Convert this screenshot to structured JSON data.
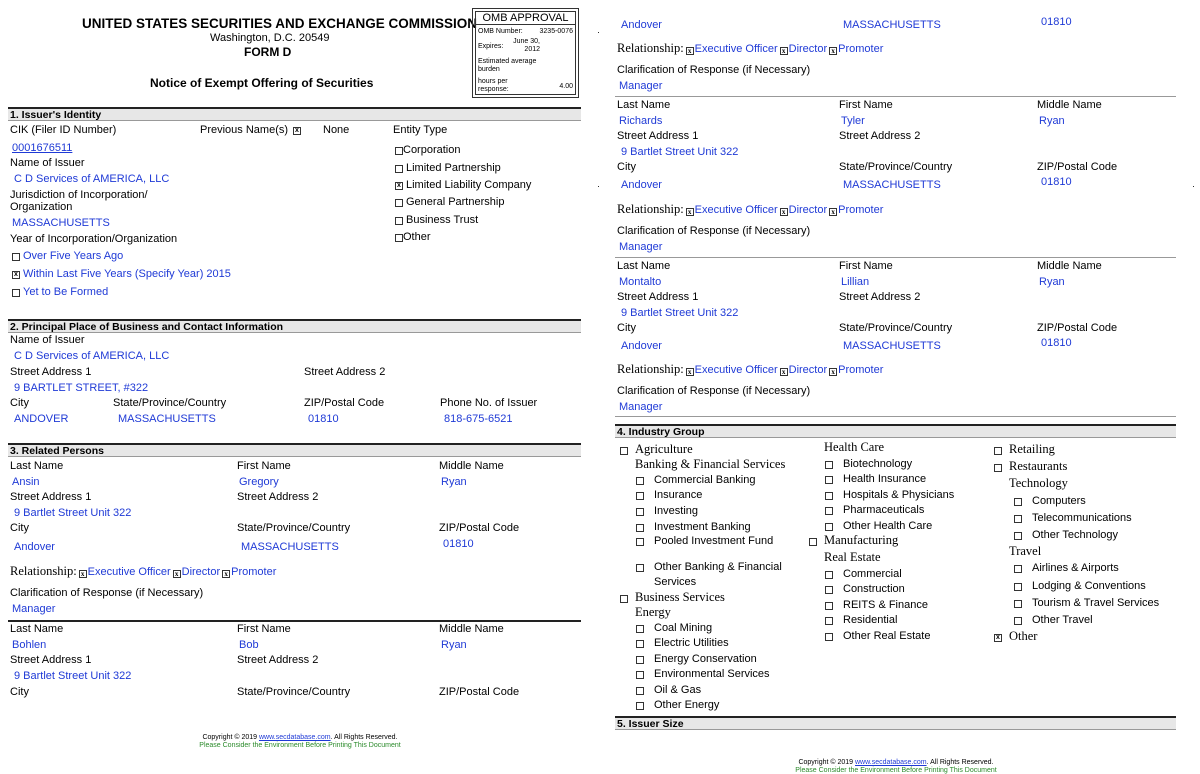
{
  "header": {
    "title": "UNITED STATES SECURITIES AND EXCHANGE COMMISSION",
    "city": "Washington, D.C. 20549",
    "form": "FORM D",
    "subtitle": "Notice of Exempt Offering of Securities"
  },
  "omb": {
    "title": "OMB APPROVAL",
    "number_label": "OMB Number:",
    "number": "3235-0076",
    "expires_label": "Expires:",
    "expires_1": "June 30,",
    "expires_2": "2012",
    "burden_1": "Estimated average",
    "burden_2": "burden",
    "hours_1": "hours per",
    "hours_2": "response:",
    "hours": "4.00"
  },
  "s1": {
    "title": "1. Issuer's Identity",
    "cik_label": "CIK (Filer ID Number)",
    "cik": "0001676511",
    "prev_label": "Previous Name(s)",
    "prev_check": "x",
    "prev_value": "None",
    "entity_label": "Entity Type",
    "issuer_label": "Name of Issuer",
    "issuer": "C D Services of AMERICA, LLC",
    "juris_label_1": "Jurisdiction of Incorporation/",
    "juris_label_2": "Organization",
    "juris": "MASSACHUSETTS",
    "year_label": "Year of Incorporation/Organization",
    "years": [
      {
        "label": "Over Five Years Ago",
        "check": ""
      },
      {
        "label": "Within Last Five Years (Specify Year) 2015",
        "check": "x"
      },
      {
        "label": "Yet to Be Formed",
        "check": ""
      }
    ],
    "entities": [
      {
        "label": "Corporation",
        "check": ""
      },
      {
        "label": "Limited Partnership",
        "check": ""
      },
      {
        "label": "Limited Liability Company",
        "check": "x"
      },
      {
        "label": "General Partnership",
        "check": ""
      },
      {
        "label": "Business Trust",
        "check": ""
      },
      {
        "label": "Other",
        "check": ""
      }
    ]
  },
  "s2": {
    "title": "2. Principal Place of Business and Contact Information",
    "issuer_label": "Name of Issuer",
    "issuer": "C D Services of AMERICA, LLC",
    "street1_label": "Street Address 1",
    "street1": "9 BARTLET STREET, #322",
    "street2_label": "Street Address 2",
    "city_label": "City",
    "city": "ANDOVER",
    "state_label": "State/Province/Country",
    "state": "MASSACHUSETTS",
    "zip_label": "ZIP/Postal Code",
    "zip": "01810",
    "phone_label": "Phone No. of Issuer",
    "phone": "818-675-6521"
  },
  "labels": {
    "last": "Last Name",
    "first": "First Name",
    "middle": "Middle Name",
    "street1": "Street Address 1",
    "street2": "Street Address 2",
    "city": "City",
    "state": "State/Province/Country",
    "zip": "ZIP/Postal Code",
    "relationship": "Relationship:",
    "exec": "Executive Officer",
    "director": "Director",
    "promoter": "Promoter",
    "clar": "Clarification of Response (if Necessary)",
    "check": "x"
  },
  "s3": {
    "title": "3. Related Persons"
  },
  "persons": [
    {
      "last": "Ansin",
      "first": "Gregory",
      "middle": "Ryan",
      "street1": "9 Bartlet Street Unit 322",
      "city": "Andover",
      "state": "MASSACHUSETTS",
      "zip": "01810",
      "clar": "Manager"
    },
    {
      "last": "Bohlen",
      "first": "Bob",
      "middle": "Ryan",
      "street1": "9 Bartlet Street Unit 322"
    },
    {
      "city": "Andover",
      "state": "MASSACHUSETTS",
      "zip": "01810",
      "clar": "Manager"
    },
    {
      "last": "Richards",
      "first": "Tyler",
      "middle": "Ryan",
      "street1": "9 Bartlet Street Unit 322",
      "city": "Andover",
      "state": "MASSACHUSETTS",
      "zip": "01810",
      "clar": "Manager"
    },
    {
      "last": "Montalto",
      "first": "Lillian",
      "middle": "Ryan",
      "street1": "9 Bartlet Street Unit 322",
      "city": "Andover",
      "state": "MASSACHUSETTS",
      "zip": "01810",
      "clar": "Manager"
    }
  ],
  "s4": {
    "title": "4. Industry Group",
    "col1": [
      {
        "t": "h",
        "label": "Agriculture"
      },
      {
        "t": "h2",
        "label": "Banking & Financial Services"
      },
      {
        "t": "i",
        "label": "Commercial Banking"
      },
      {
        "t": "i",
        "label": "Insurance"
      },
      {
        "t": "i",
        "label": "Investing"
      },
      {
        "t": "i",
        "label": "Investment Banking"
      },
      {
        "t": "i",
        "label": "Pooled Investment Fund"
      },
      {
        "t": "i",
        "label": "Other Banking & Financial"
      },
      {
        "t": "c",
        "label": "Services"
      },
      {
        "t": "h",
        "label": "Business Services"
      },
      {
        "t": "h2",
        "label": "Energy"
      },
      {
        "t": "i",
        "label": "Coal Mining"
      },
      {
        "t": "i",
        "label": "Electric Utilities"
      },
      {
        "t": "i",
        "label": "Energy Conservation"
      },
      {
        "t": "i",
        "label": "Environmental Services"
      },
      {
        "t": "i",
        "label": "Oil & Gas"
      },
      {
        "t": "i",
        "label": "Other Energy"
      }
    ],
    "col2": [
      {
        "t": "h2",
        "label": "Health Care"
      },
      {
        "t": "i",
        "label": "Biotechnology"
      },
      {
        "t": "i",
        "label": "Health Insurance"
      },
      {
        "t": "i",
        "label": "Hospitals & Physicians"
      },
      {
        "t": "i",
        "label": "Pharmaceuticals"
      },
      {
        "t": "i",
        "label": "Other Health Care"
      },
      {
        "t": "h",
        "label": "Manufacturing"
      },
      {
        "t": "h2",
        "label": "Real Estate"
      },
      {
        "t": "i",
        "label": "Commercial"
      },
      {
        "t": "i",
        "label": "Construction"
      },
      {
        "t": "i",
        "label": "REITS & Finance"
      },
      {
        "t": "i",
        "label": "Residential"
      },
      {
        "t": "i",
        "label": "Other Real Estate"
      }
    ],
    "col3": [
      {
        "t": "h",
        "label": "Retailing"
      },
      {
        "t": "h",
        "label": "Restaurants"
      },
      {
        "t": "h2",
        "label": "Technology"
      },
      {
        "t": "i",
        "label": "Computers"
      },
      {
        "t": "i",
        "label": "Telecommunications"
      },
      {
        "t": "i",
        "label": "Other Technology"
      },
      {
        "t": "h2",
        "label": "Travel"
      },
      {
        "t": "i",
        "label": "Airlines & Airports"
      },
      {
        "t": "i",
        "label": "Lodging & Conventions"
      },
      {
        "t": "i",
        "label": "Tourism & Travel Services"
      },
      {
        "t": "i",
        "label": "Other Travel"
      },
      {
        "t": "hx",
        "label": "Other"
      }
    ]
  },
  "s5": {
    "title": "5. Issuer Size"
  },
  "footer": {
    "copy_pre": "Copyright © 2019 ",
    "link": "www.secdatabase.com",
    "copy_post": ". All Rights Reserved.",
    "note": "Please Consider the Environment Before Printing This Document"
  }
}
